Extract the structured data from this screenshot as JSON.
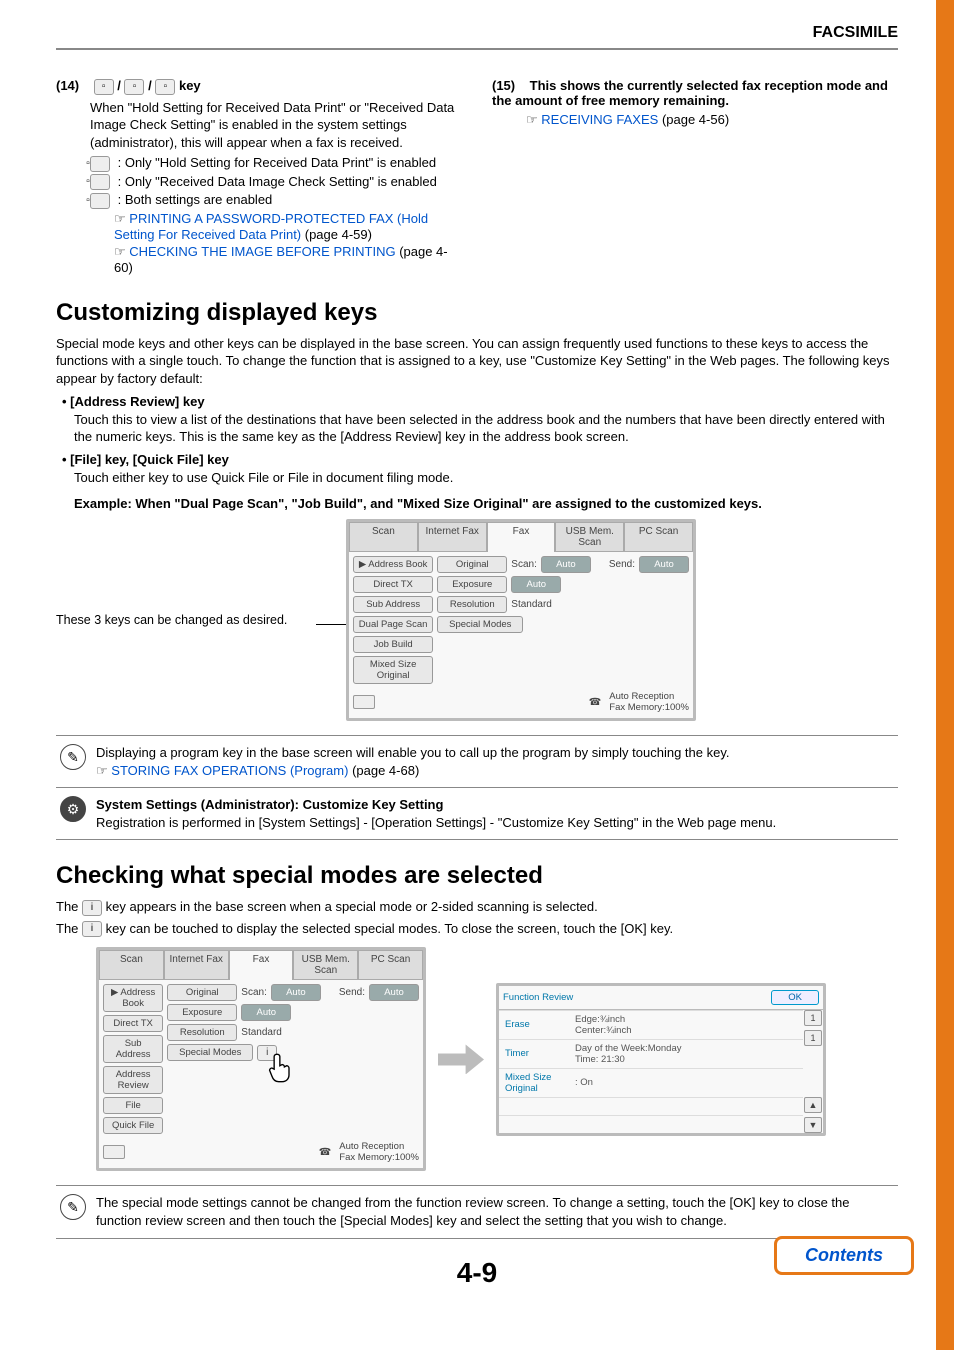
{
  "header": "FACSIMILE",
  "item14": {
    "num": "(14)",
    "key_suffix": " key",
    "slash": " / ",
    "desc": "When \"Hold Setting for Received Data Print\" or \"Received Data Image Check Setting\" is enabled in the system settings (administrator), this will appear when a fax is received.",
    "opt1": " : Only \"Hold Setting for Received Data Print\" is enabled",
    "opt2": " : Only \"Received Data Image Check Setting\" is enabled",
    "opt3": " : Both settings are enabled",
    "hand": "☞ ",
    "link1": "PRINTING A PASSWORD-PROTECTED FAX (Hold Setting For Received Data Print)",
    "link1_pg": " (page 4-59)",
    "link2": "CHECKING THE IMAGE BEFORE PRINTING",
    "link2_pg": " (page 4-60)"
  },
  "item15": {
    "num": "(15)",
    "title": "This shows the currently selected fax reception mode and the amount of free memory remaining.",
    "hand": "☞ ",
    "link": "RECEIVING FAXES",
    "link_pg": " (page 4-56)"
  },
  "sect1": {
    "title": "Customizing displayed keys",
    "para": "Special mode keys and other keys can be displayed in the base screen. You can assign frequently used functions to these keys to access the functions with a single touch. To change the function that is assigned to a key, use \"Customize Key Setting\" in the Web pages. The following keys appear by factory default:",
    "b1_title": "• [Address Review] key",
    "b1_body": "Touch this to view a list of the destinations that have been selected in the address book and the numbers that have been directly entered with the numeric keys. This is the same key as the [Address Review] key in the address book screen.",
    "b2_title": "• [File] key, [Quick File] key",
    "b2_body": "Touch either key to use Quick File or File in document filing mode.",
    "example": "Example: When \"Dual Page Scan\", \"Job Build\", and \"Mixed Size Original\" are assigned to the customized keys.",
    "caption": "These 3 keys can be changed as desired."
  },
  "panel1": {
    "tabs": [
      "Scan",
      "Internet Fax",
      "Fax",
      "USB Mem. Scan",
      "PC Scan"
    ],
    "side": [
      "Address Book",
      "Direct TX",
      "Sub Address",
      "Dual Page Scan",
      "Job Build",
      "Mixed Size Original"
    ],
    "r_original": "Original",
    "r_scan": "Scan:",
    "r_auto": "Auto",
    "r_send": "Send:",
    "r_exposure": "Exposure",
    "r_resolution": "Resolution",
    "r_standard": "Standard",
    "r_special": "Special Modes",
    "foot_reception": "Auto Reception",
    "foot_mem": "Fax Memory:100%"
  },
  "note1": {
    "line1": "Displaying a program key in the base screen will enable you to call up the program by simply touching the key.",
    "hand": "☞ ",
    "link": "STORING FAX OPERATIONS (Program)",
    "link_pg": " (page 4-68)"
  },
  "note2": {
    "title": "System Settings (Administrator): Customize Key Setting",
    "body": "Registration is performed in [System Settings] - [Operation Settings] - \"Customize Key Setting\" in the Web page menu."
  },
  "sect2": {
    "title": "Checking what special modes are selected",
    "line1a": "The ",
    "line1b": " key appears in the base screen when a special mode or 2-sided scanning is selected.",
    "line2a": "The ",
    "line2b": " key can be touched to display the selected special modes. To close the screen, touch the [OK] key."
  },
  "panel2": {
    "tabs": [
      "Scan",
      "Internet Fax",
      "Fax",
      "USB Mem. Scan",
      "PC Scan"
    ],
    "side": [
      "Address Book",
      "Direct TX",
      "Sub Address",
      "Address Review",
      "File",
      "Quick File"
    ],
    "r_original": "Original",
    "r_scan": "Scan:",
    "r_auto": "Auto",
    "r_send": "Send:",
    "r_exposure": "Exposure",
    "r_resolution": "Resolution",
    "r_standard": "Standard",
    "r_special": "Special Modes",
    "foot_reception": "Auto Reception",
    "foot_mem": "Fax Memory:100%"
  },
  "review": {
    "title": "Function Review",
    "ok": "OK",
    "rows": [
      {
        "k": "Erase",
        "v": "Edge:¾inch\nCenter:¾inch"
      },
      {
        "k": "Timer",
        "v": "Day of the Week:Monday\nTime: 21:30"
      },
      {
        "k": "Mixed Size Original",
        "v": ": On"
      }
    ],
    "page_ind_top": "1",
    "page_ind_bot": "1"
  },
  "note3": "The special mode settings cannot be changed from the function review screen. To change a setting, touch the [OK] key to close the function review screen and then touch the [Special Modes] key and select the setting that you wish to change.",
  "page_num": "4-9",
  "contents": "Contents"
}
